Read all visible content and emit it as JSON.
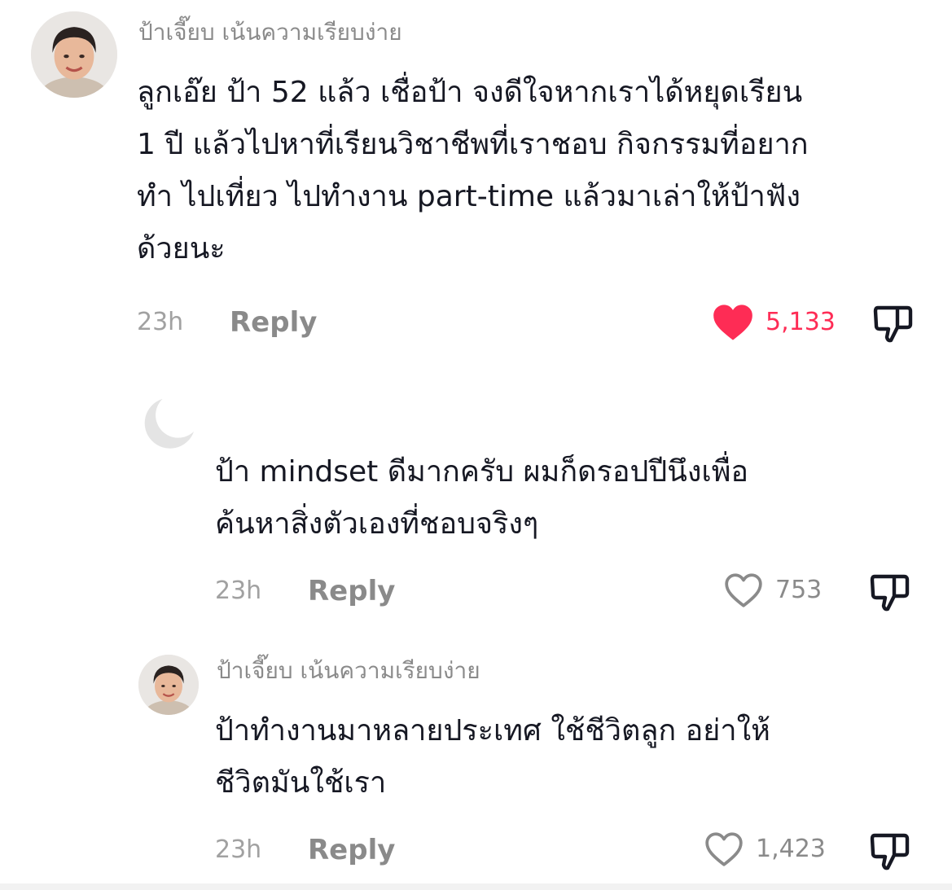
{
  "colors": {
    "liked_heart": "#fe2c55",
    "muted_text": "#8a8a8a",
    "body_text": "#161823"
  },
  "comments": [
    {
      "username": "ป้าเจี๊ยบ เน้นความเรียบง่าย",
      "avatar_icon": "profile-photo",
      "lines": [
        "ลูกเอ๊ย ป้า 52 แล้ว เชื่อป้า จงดีใจหากเราได้หยุดเรียน",
        "1 ปี แล้วไปหาที่เรียนวิชาชีพที่เราชอบ กิจกรรมที่อยาก",
        "ทำ ไปเที่ยว ไปทำงาน part-time แล้วมาเล่าให้ป้าฟัง",
        "ด้วยนะ"
      ],
      "time": "23h",
      "reply_label": "Reply",
      "likes": "5,133",
      "liked": true,
      "like_icon": "heart-filled-icon",
      "dislike_icon": "thumbs-down-icon"
    }
  ],
  "replies": [
    {
      "username": "",
      "avatar_icon": "moon-avatar",
      "lines": [
        "ป้า mindset ดีมากครับ ผมก็ดรอปปีนึงเพื่อ",
        "ค้นหาสิ่งตัวเองที่ชอบจริงๆ"
      ],
      "time": "23h",
      "reply_label": "Reply",
      "likes": "753",
      "liked": false,
      "like_icon": "heart-outline-icon",
      "dislike_icon": "thumbs-down-icon"
    },
    {
      "username": "ป้าเจี๊ยบ เน้นความเรียบง่าย",
      "avatar_icon": "profile-photo",
      "lines": [
        "ป้าทำงานมาหลายประเทศ ใช้ชีวิตลูก อย่าให้",
        "ชีวิตมันใช้เรา"
      ],
      "time": "23h",
      "reply_label": "Reply",
      "likes": "1,423",
      "liked": false,
      "like_icon": "heart-outline-icon",
      "dislike_icon": "thumbs-down-icon"
    }
  ]
}
